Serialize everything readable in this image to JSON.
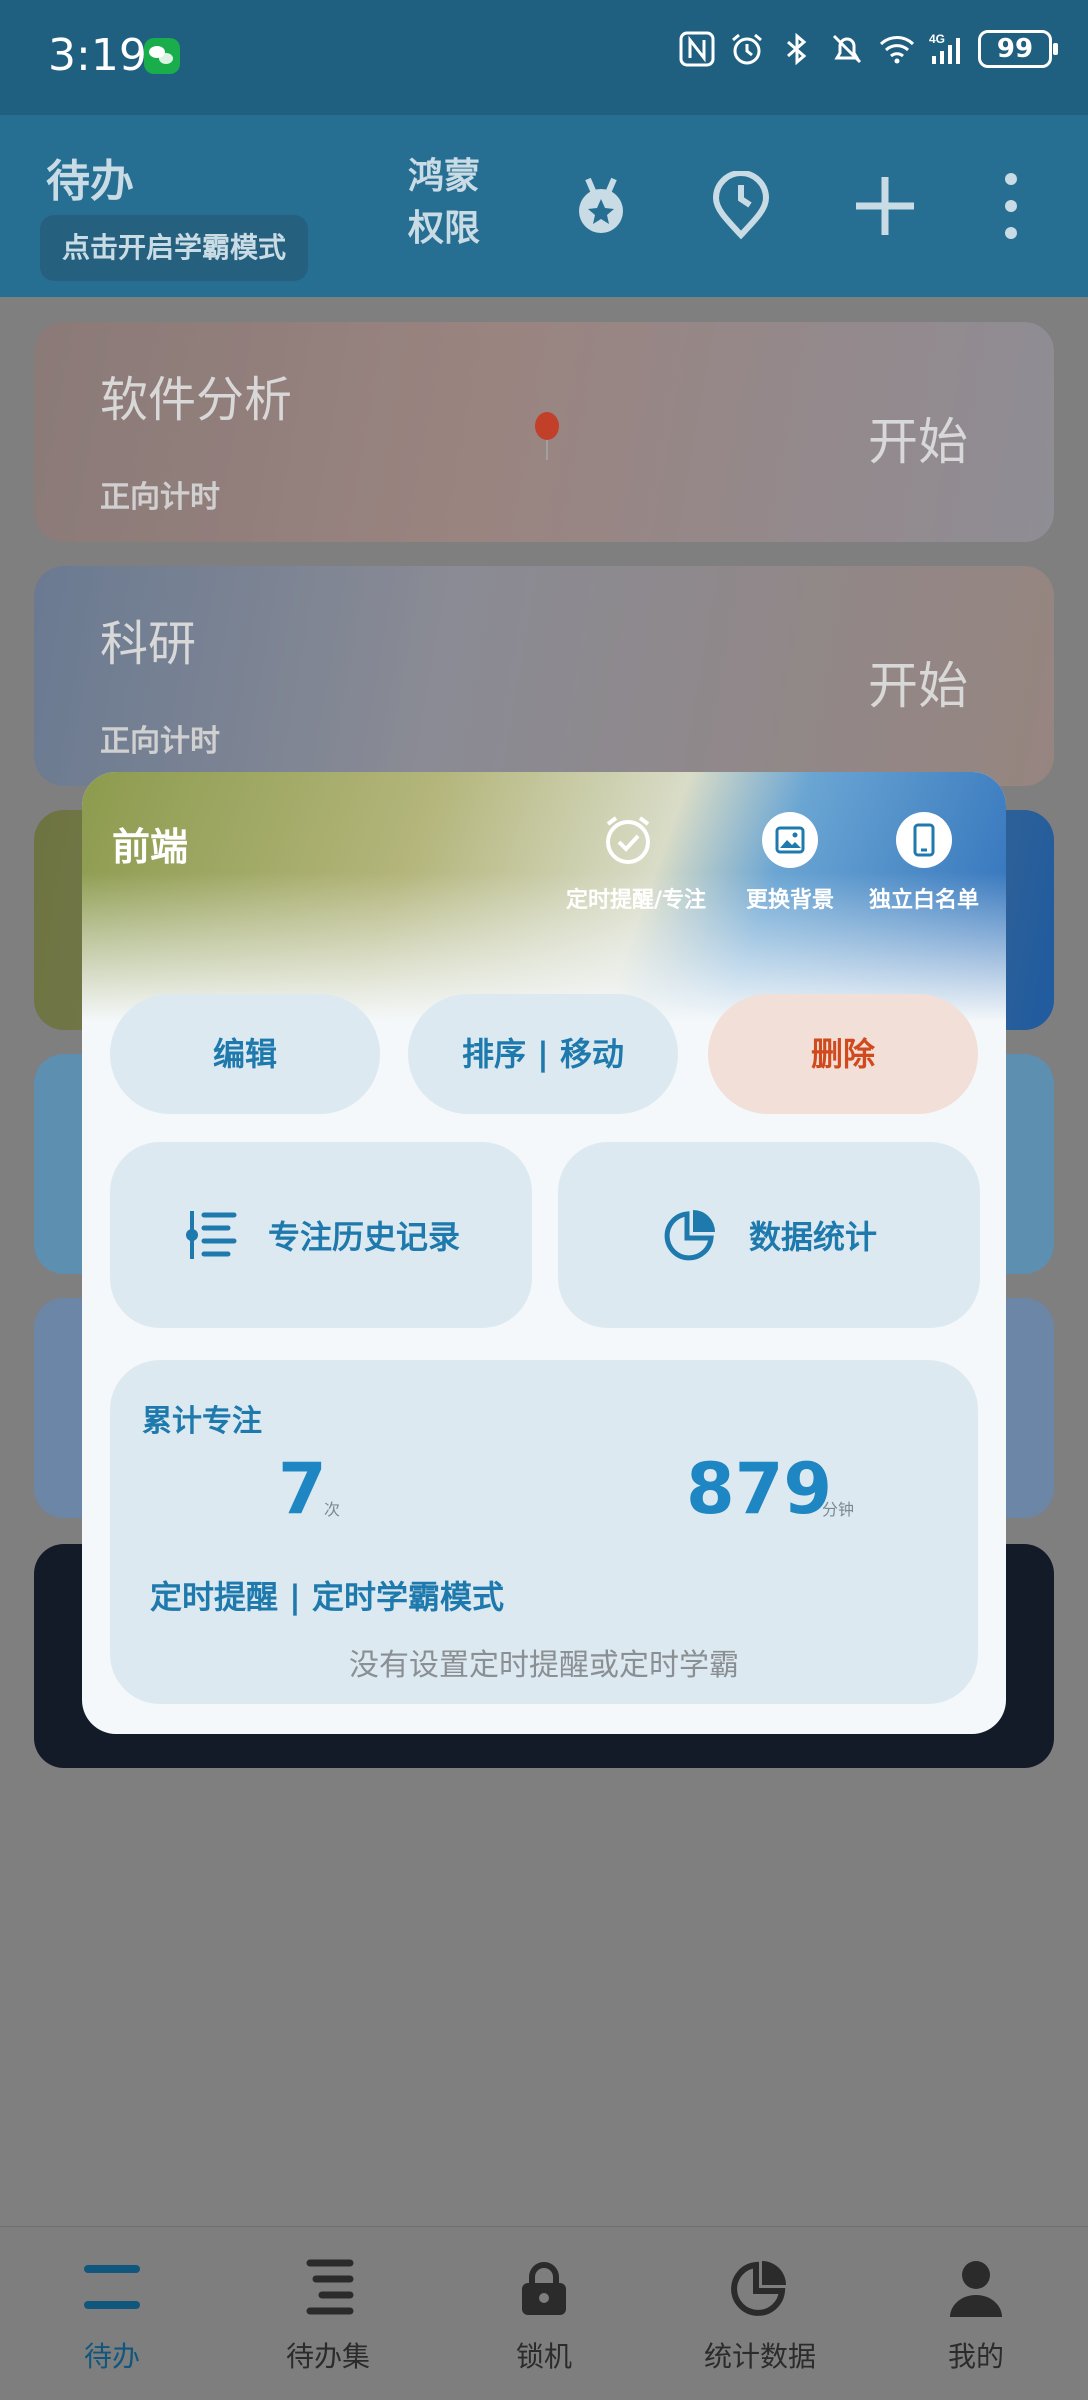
{
  "status_bar": {
    "time": "3:19",
    "battery": "99",
    "icons": [
      "wechat-icon",
      "nfc-icon",
      "alarm-icon",
      "bluetooth-icon",
      "mute-icon",
      "wifi-icon",
      "signal-4g-icon",
      "battery-icon"
    ]
  },
  "header": {
    "title": "待办",
    "mode_button": "点击开启学霸模式",
    "permission_line1": "鸿蒙",
    "permission_line2": "权限",
    "icons": [
      "medal-icon",
      "clock-pin-icon",
      "add-icon",
      "more-icon"
    ]
  },
  "tasks": [
    {
      "title": "软件分析",
      "type": "正向计时",
      "action": "开始"
    },
    {
      "title": "科研",
      "type": "正向计时",
      "action": "开始"
    }
  ],
  "dialog": {
    "task_name": "前端",
    "actions": [
      {
        "label": "定时提醒/专注",
        "icon": "alarm-check-icon"
      },
      {
        "label": "更换背景",
        "icon": "image-icon"
      },
      {
        "label": "独立白名单",
        "icon": "phone-icon"
      }
    ],
    "edit": "编辑",
    "sort_move": "排序 | 移动",
    "delete": "删除",
    "history": "专注历史记录",
    "stats": "数据统计",
    "summary": {
      "title": "累计专注",
      "count": "7",
      "count_unit": "次",
      "minutes": "879",
      "minutes_unit": "分钟",
      "reminder_title": "定时提醒 | 定时学霸模式",
      "reminder_empty": "没有设置定时提醒或定时学霸"
    }
  },
  "nav": [
    {
      "label": "待办",
      "icon": "todo-icon",
      "active": true
    },
    {
      "label": "待办集",
      "icon": "todo-set-icon",
      "active": false
    },
    {
      "label": "锁机",
      "icon": "lock-icon",
      "active": false
    },
    {
      "label": "统计数据",
      "icon": "pie-chart-icon",
      "active": false
    },
    {
      "label": "我的",
      "icon": "person-icon",
      "active": false
    }
  ],
  "colors": {
    "accent": "#1e79ad",
    "danger": "#d14a1e",
    "header": "#276f92",
    "status_bar": "#1f5f80"
  }
}
